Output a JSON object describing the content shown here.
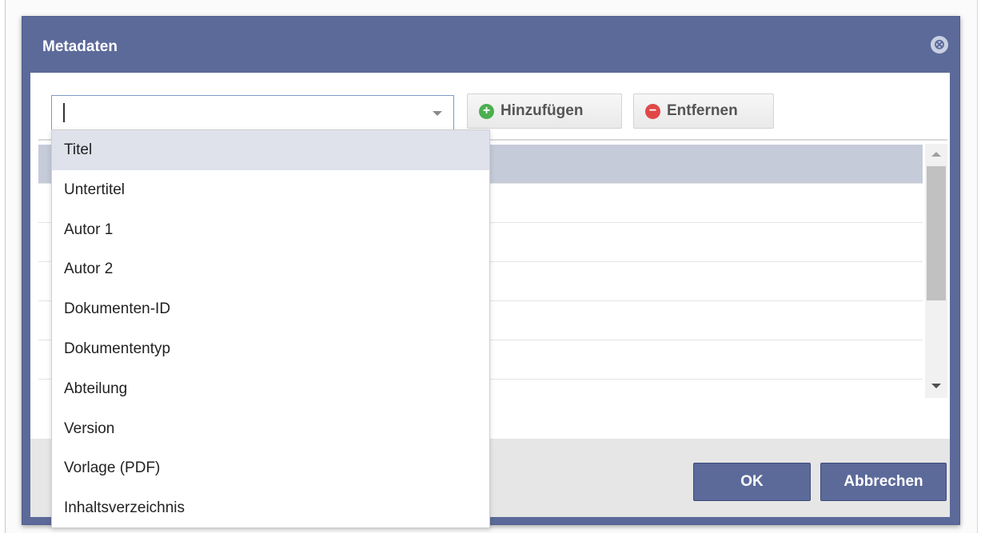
{
  "background": {
    "partial_text": ""
  },
  "dialog": {
    "title": "Metadaten",
    "close_glyph": "⊗",
    "combo": {
      "value": "",
      "placeholder": ""
    },
    "toolbar": {
      "add_label": "Hinzufügen",
      "remove_label": "Entfernen"
    },
    "footer": {
      "ok_label": "OK",
      "cancel_label": "Abbrechen"
    },
    "grid_rows": 6
  },
  "dropdown": {
    "items": [
      "Titel",
      "Untertitel",
      "Autor 1",
      "Autor 2",
      "Dokumenten-ID",
      "Dokumententyp",
      "Abteilung",
      "Version",
      "Vorlage (PDF)",
      "Inhaltsverzeichnis"
    ],
    "highlighted_index": 0
  },
  "colors": {
    "dialog_header": "#5c6a9a",
    "selected_row": "#c6cbd9",
    "highlight": "#dfe1eb",
    "add_icon": "#4caf50",
    "remove_icon": "#e04848"
  },
  "icons": [
    "close-icon",
    "dropdown-arrow-icon",
    "plus-icon",
    "minus-icon",
    "scroll-up-icon",
    "scroll-down-icon"
  ]
}
